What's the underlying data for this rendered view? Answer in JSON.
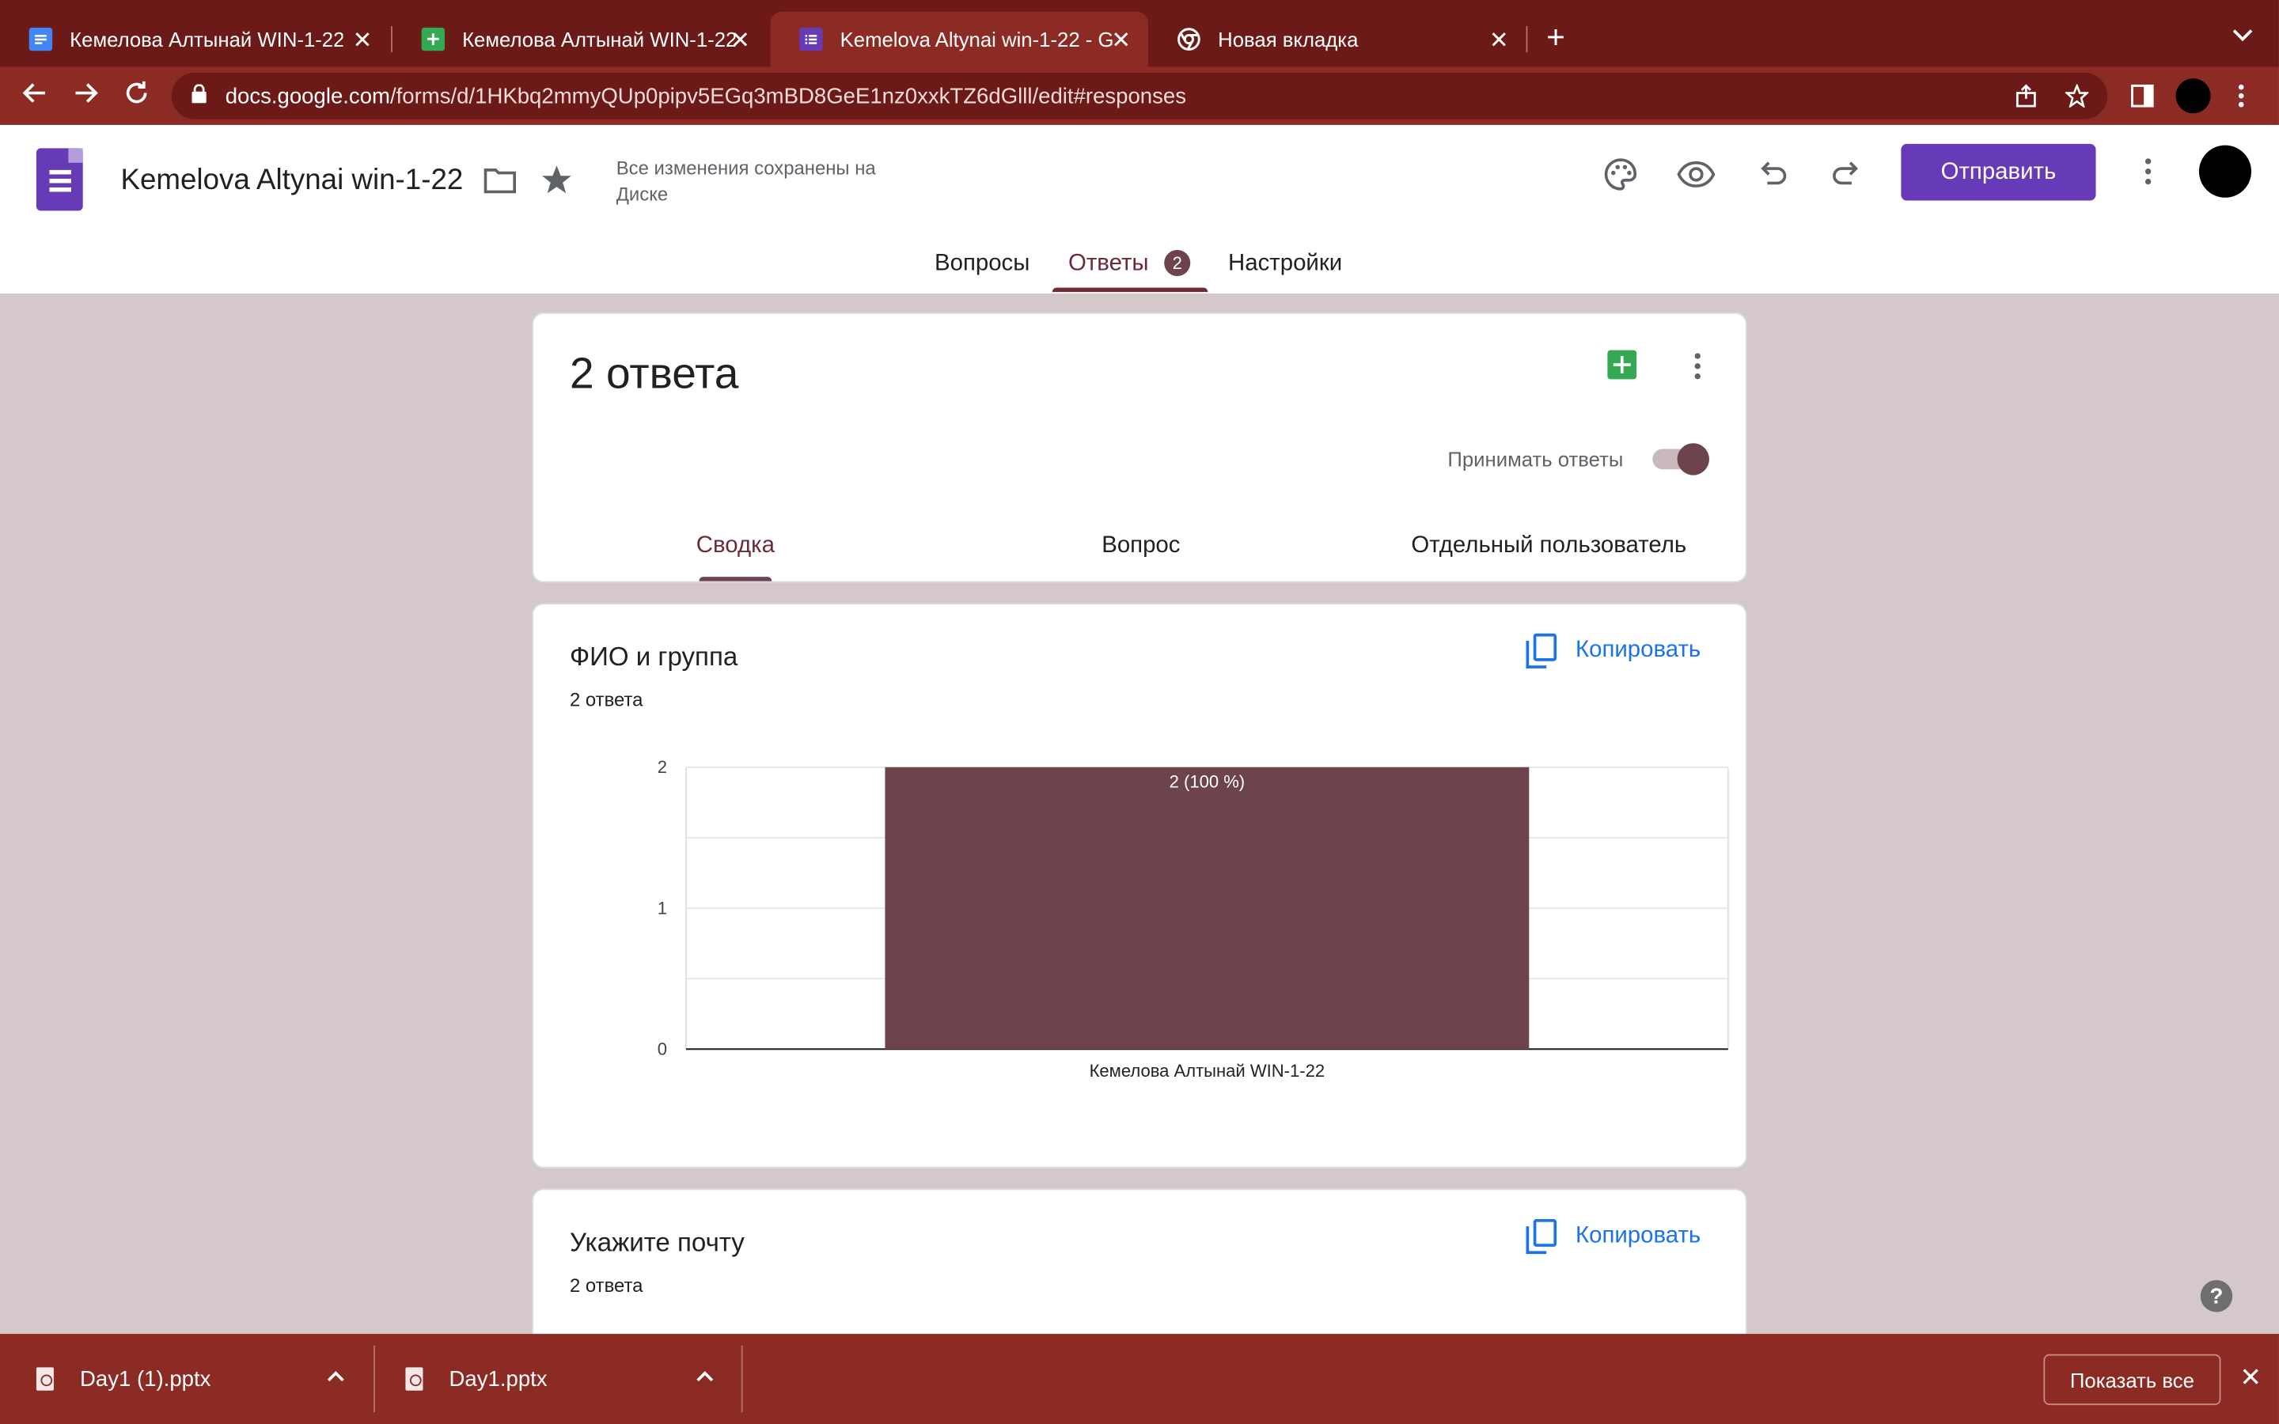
{
  "browser": {
    "tabs": [
      {
        "title": "Кемелова Алтынай WIN-1-22",
        "icon": "google-docs-icon",
        "color": "#4285f4"
      },
      {
        "title": "Кемелова Алтынай WIN-1-22",
        "icon": "google-sheets-icon",
        "color": "#34a853"
      },
      {
        "title": "Kemelova Altynai win-1-22 - Go",
        "icon": "google-forms-icon",
        "color": "#673ab7"
      },
      {
        "title": "Новая вкладка",
        "icon": "chrome-icon",
        "color": "#ffffff"
      }
    ],
    "active_tab": 2,
    "url_domain": "docs.google.com",
    "url_path": "/forms/d/1HKbq2mmyQUp0pipv5EGq3mBD8GeE1nz0xxkTZ6dGlll/edit#responses"
  },
  "header": {
    "title": "Kemelova Altynai win-1-22",
    "saved_status": "Все изменения сохранены на Диске",
    "send_label": "Отправить",
    "tabs": [
      {
        "label": "Вопросы"
      },
      {
        "label": "Ответы"
      },
      {
        "label": "Настройки"
      }
    ],
    "responses_badge": "2",
    "active_tab": "Ответы"
  },
  "summary": {
    "count_title": "2 ответа",
    "accepting_label": "Принимать ответы",
    "accepting": true,
    "tabs": [
      {
        "label": "Сводка"
      },
      {
        "label": "Вопрос"
      },
      {
        "label": "Отдельный пользователь"
      }
    ],
    "active_tab": "Сводка"
  },
  "questions": [
    {
      "title": "ФИО и группа",
      "count": "2 ответа",
      "copy_label": "Копировать"
    },
    {
      "title": "Укажите почту",
      "count": "2 ответа",
      "copy_label": "Копировать"
    }
  ],
  "chart_data": {
    "type": "bar",
    "categories": [
      "Кемелова Алтынай WIN-1-22"
    ],
    "values": [
      2
    ],
    "data_labels": [
      "2 (100 %)"
    ],
    "ylim": [
      0,
      2
    ],
    "yticks": [
      "0",
      "1",
      "2"
    ],
    "grid": true,
    "bar_color": "#6d444c"
  },
  "downloads": {
    "items": [
      {
        "name": "Day1 (1).pptx"
      },
      {
        "name": "Day1.pptx"
      }
    ],
    "show_all_label": "Показать все"
  },
  "help_label": "?"
}
